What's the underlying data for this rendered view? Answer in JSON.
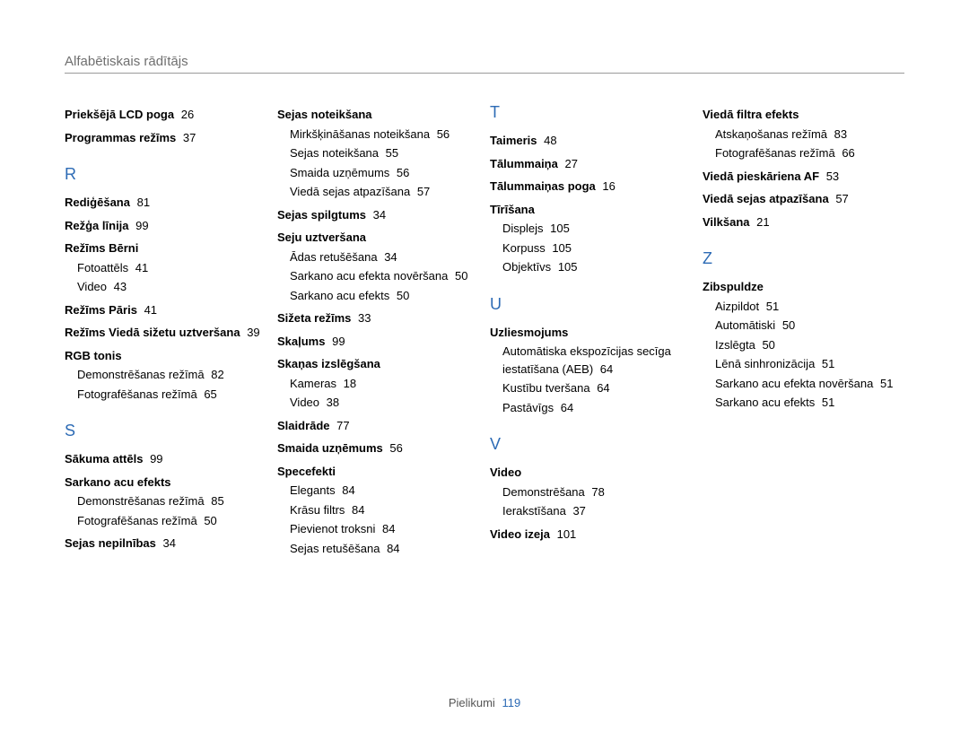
{
  "header": "Alfabētiskais rādītājs",
  "footer": {
    "label": "Pielikumi",
    "page": "119"
  },
  "columns": [
    [
      {
        "type": "bold",
        "label": "Priekšējā LCD poga",
        "page": "26"
      },
      {
        "type": "bold",
        "label": "Programmas režīms",
        "page": "37"
      },
      {
        "type": "letter",
        "label": "R"
      },
      {
        "type": "bold",
        "label": "Rediģēšana",
        "page": "81"
      },
      {
        "type": "bold",
        "label": "Režģa līnija",
        "page": "99"
      },
      {
        "type": "bold",
        "label": "Režīms Bērni"
      },
      {
        "type": "sub",
        "label": "Fotoattēls",
        "page": "41"
      },
      {
        "type": "sub",
        "label": "Video",
        "page": "43"
      },
      {
        "type": "bold",
        "label": "Režīms Pāris",
        "page": "41"
      },
      {
        "type": "bold",
        "label": "Režīms Viedā sižetu uztveršana",
        "page": "39"
      },
      {
        "type": "bold",
        "label": "RGB tonis"
      },
      {
        "type": "sub",
        "label": "Demonstrēšanas režīmā",
        "page": "82"
      },
      {
        "type": "sub",
        "label": "Fotografēšanas režīmā",
        "page": "65"
      },
      {
        "type": "letter",
        "label": "S"
      },
      {
        "type": "bold",
        "label": "Sākuma attēls",
        "page": "99"
      },
      {
        "type": "bold",
        "label": "Sarkano acu efekts"
      },
      {
        "type": "sub",
        "label": "Demonstrēšanas režīmā",
        "page": "85"
      },
      {
        "type": "sub",
        "label": "Fotografēšanas režīmā",
        "page": "50"
      },
      {
        "type": "bold",
        "label": "Sejas nepilnības",
        "page": "34"
      }
    ],
    [
      {
        "type": "bold",
        "label": "Sejas noteikšana"
      },
      {
        "type": "sub",
        "label": "Mirkšķināšanas noteikšana",
        "page": "56"
      },
      {
        "type": "sub",
        "label": "Sejas noteikšana",
        "page": "55"
      },
      {
        "type": "sub",
        "label": "Smaida uzņēmums",
        "page": "56"
      },
      {
        "type": "sub",
        "label": "Viedā sejas atpazīšana",
        "page": "57"
      },
      {
        "type": "bold",
        "label": "Sejas spilgtums",
        "page": "34"
      },
      {
        "type": "bold",
        "label": "Seju uztveršana"
      },
      {
        "type": "sub",
        "label": "Ādas retušēšana",
        "page": "34"
      },
      {
        "type": "sub",
        "label": "Sarkano acu efekta novēršana",
        "page": "50"
      },
      {
        "type": "sub",
        "label": "Sarkano acu efekts",
        "page": "50"
      },
      {
        "type": "bold",
        "label": "Sižeta režīms",
        "page": "33"
      },
      {
        "type": "bold",
        "label": "Skaļums",
        "page": "99"
      },
      {
        "type": "bold",
        "label": "Skaņas izslēgšana"
      },
      {
        "type": "sub",
        "label": "Kameras",
        "page": "18"
      },
      {
        "type": "sub",
        "label": "Video",
        "page": "38"
      },
      {
        "type": "bold",
        "label": "Slaidrāde",
        "page": "77"
      },
      {
        "type": "bold",
        "label": "Smaida uzņēmums",
        "page": "56"
      },
      {
        "type": "bold",
        "label": "Specefekti"
      },
      {
        "type": "sub",
        "label": "Elegants",
        "page": "84"
      },
      {
        "type": "sub",
        "label": "Krāsu filtrs",
        "page": "84"
      },
      {
        "type": "sub",
        "label": "Pievienot troksni",
        "page": "84"
      },
      {
        "type": "sub",
        "label": "Sejas retušēšana",
        "page": "84"
      }
    ],
    [
      {
        "type": "letter",
        "label": "T"
      },
      {
        "type": "bold",
        "label": "Taimeris",
        "page": "48"
      },
      {
        "type": "bold",
        "label": "Tālummaiņa",
        "page": "27"
      },
      {
        "type": "bold",
        "label": "Tālummaiņas poga",
        "page": "16"
      },
      {
        "type": "bold",
        "label": "Tīrīšana"
      },
      {
        "type": "sub",
        "label": "Displejs",
        "page": "105"
      },
      {
        "type": "sub",
        "label": "Korpuss",
        "page": "105"
      },
      {
        "type": "sub",
        "label": "Objektīvs",
        "page": "105"
      },
      {
        "type": "letter",
        "label": "U"
      },
      {
        "type": "bold",
        "label": "Uzliesmojums"
      },
      {
        "type": "sub",
        "label": "Automātiska ekspozīcijas secīga iestatīšana (AEB)",
        "page": "64"
      },
      {
        "type": "sub",
        "label": "Kustību tveršana",
        "page": "64"
      },
      {
        "type": "sub",
        "label": "Pastāvīgs",
        "page": "64"
      },
      {
        "type": "letter",
        "label": "V"
      },
      {
        "type": "bold",
        "label": "Video"
      },
      {
        "type": "sub",
        "label": "Demonstrēšana",
        "page": "78"
      },
      {
        "type": "sub",
        "label": "Ierakstīšana",
        "page": "37"
      },
      {
        "type": "bold",
        "label": "Video izeja",
        "page": "101"
      }
    ],
    [
      {
        "type": "bold",
        "label": "Viedā filtra efekts"
      },
      {
        "type": "sub",
        "label": "Atskaņošanas režīmā",
        "page": "83"
      },
      {
        "type": "sub",
        "label": "Fotografēšanas režīmā",
        "page": "66"
      },
      {
        "type": "bold",
        "label": "Viedā pieskāriena AF",
        "page": "53"
      },
      {
        "type": "bold",
        "label": "Viedā sejas atpazīšana",
        "page": "57"
      },
      {
        "type": "bold",
        "label": "Vilkšana",
        "page": "21"
      },
      {
        "type": "letter",
        "label": "Z"
      },
      {
        "type": "bold",
        "label": "Zibspuldze"
      },
      {
        "type": "sub",
        "label": "Aizpildot",
        "page": "51"
      },
      {
        "type": "sub",
        "label": "Automātiski",
        "page": "50"
      },
      {
        "type": "sub",
        "label": "Izslēgta",
        "page": "50"
      },
      {
        "type": "sub",
        "label": "Lēnā sinhronizācija",
        "page": "51"
      },
      {
        "type": "sub",
        "label": "Sarkano acu efekta novēršana",
        "page": "51"
      },
      {
        "type": "sub",
        "label": "Sarkano acu efekts",
        "page": "51"
      }
    ]
  ]
}
